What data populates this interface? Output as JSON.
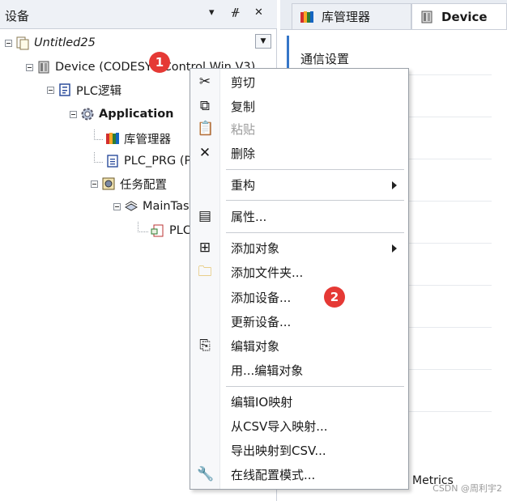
{
  "panel": {
    "title": "设备",
    "btn_dropdown": "▾",
    "btn_pin": "ᚌ",
    "btn_close": "✕"
  },
  "tree": [
    {
      "label": "Untitled25",
      "icon": "project-icon",
      "style": "italic"
    },
    {
      "label": "Device (CODESYS Control Win V3)",
      "icon": "device-icon",
      "style": ""
    },
    {
      "label": "PLC逻辑",
      "icon": "plc-logic-icon",
      "style": ""
    },
    {
      "label": "Application",
      "icon": "application-gear-icon",
      "style": "bold"
    },
    {
      "label": "库管理器",
      "icon": "library-books-icon",
      "style": ""
    },
    {
      "label": "PLC_PRG (PRG)",
      "icon": "program-icon",
      "style": ""
    },
    {
      "label": "任务配置",
      "icon": "task-config-icon",
      "style": ""
    },
    {
      "label": "MainTask",
      "icon": "task-icon",
      "style": ""
    },
    {
      "label": "PLC_PRG",
      "icon": "task-call-icon",
      "style": ""
    }
  ],
  "tabs": [
    {
      "label": "库管理器",
      "icon": "library-books-icon"
    },
    {
      "label": "Device",
      "icon": "device-icon"
    }
  ],
  "editor": {
    "title": "通信设置",
    "metrics": "Metrics"
  },
  "menu": [
    {
      "label": "剪切",
      "icon": "scissors-icon",
      "glyph": "✂",
      "disabled": false
    },
    {
      "label": "复制",
      "icon": "copy-icon",
      "glyph": "⧉",
      "disabled": false
    },
    {
      "label": "粘贴",
      "icon": "paste-icon",
      "glyph": "📋",
      "disabled": true
    },
    {
      "label": "删除",
      "icon": "delete-x-icon",
      "glyph": "✕",
      "disabled": false
    },
    {
      "label": "重构",
      "icon": "",
      "glyph": "",
      "disabled": false,
      "submenu": true
    },
    {
      "label": "属性...",
      "icon": "properties-icon",
      "glyph": "▤",
      "disabled": false
    },
    {
      "label": "添加对象",
      "icon": "add-object-icon",
      "glyph": "⊞",
      "disabled": false,
      "submenu": true
    },
    {
      "label": "添加文件夹...",
      "icon": "folder-icon",
      "glyph": "🗀",
      "disabled": false
    },
    {
      "label": "添加设备...",
      "icon": "",
      "glyph": "",
      "disabled": false
    },
    {
      "label": "更新设备...",
      "icon": "",
      "glyph": "",
      "disabled": false
    },
    {
      "label": "编辑对象",
      "icon": "edit-object-icon",
      "glyph": "⎘",
      "disabled": false
    },
    {
      "label": "用...编辑对象",
      "icon": "",
      "glyph": "",
      "disabled": false
    },
    {
      "label": "编辑IO映射",
      "icon": "",
      "glyph": "",
      "disabled": false
    },
    {
      "label": "从CSV导入映射...",
      "icon": "",
      "glyph": "",
      "disabled": false
    },
    {
      "label": "导出映射到CSV...",
      "icon": "",
      "glyph": "",
      "disabled": false
    },
    {
      "label": "在线配置模式...",
      "icon": "online-config-icon",
      "glyph": "🔧",
      "disabled": false
    }
  ],
  "badges": [
    "1",
    "2"
  ],
  "watermark": "CSDN @周利宇2"
}
